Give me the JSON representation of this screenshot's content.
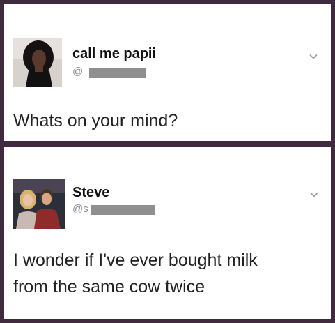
{
  "tweets": [
    {
      "display_name": "call me papii",
      "handle_prefix": "@",
      "text": "Whats on your mind?"
    },
    {
      "display_name": "Steve",
      "handle_prefix": "@s",
      "text_line1": "I wonder if I've ever bought milk",
      "text_line2": "from the same cow twice"
    }
  ],
  "icons": {
    "menu": "chevron-down-icon"
  },
  "colors": {
    "frame": "#3f2a3e",
    "card": "#ffffff",
    "handle": "#8a8d91",
    "redaction": "#8f8f8f"
  }
}
